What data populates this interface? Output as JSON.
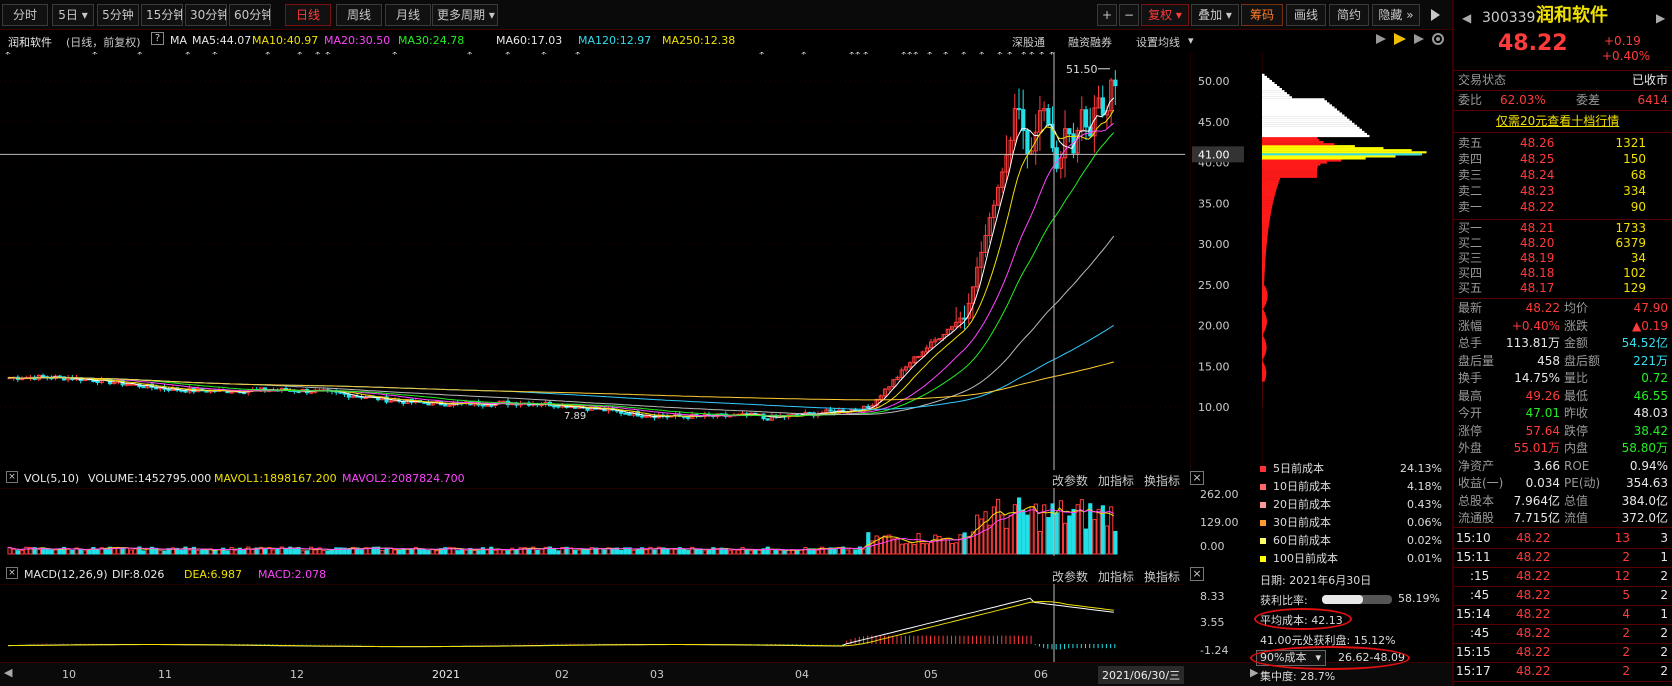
{
  "toolbar": {
    "periods": [
      "分时",
      "5日",
      "5分钟",
      "15分钟",
      "30分钟",
      "60分钟",
      "日线",
      "周线",
      "月线",
      "更多周期"
    ],
    "active_period": "日线",
    "right_buttons": [
      "+",
      "−",
      "复权",
      "叠加",
      "筹码",
      "画线",
      "简约",
      "隐藏"
    ]
  },
  "ma_line": {
    "name": "润和软件",
    "mode": "(日线，前复权)",
    "ma_label": "MA",
    "ma5": "MA5:44.07",
    "ma10": "MA10:40.97",
    "ma20": "MA20:30.50",
    "ma30": "MA30:24.78",
    "ma60": "MA60:17.03",
    "ma120": "MA120:12.97",
    "ma250": "MA250:12.38",
    "link1": "深股通",
    "link2": "融资融券",
    "link3": "设置均线"
  },
  "price_axis": {
    "ticks": [
      "50.00",
      "45.00",
      "40.00",
      "35.00",
      "30.00",
      "25.00",
      "20.00",
      "15.00",
      "10.00"
    ],
    "current_line": "41.00",
    "high_label": "51.50",
    "low_label": "7.89"
  },
  "vol_panel": {
    "label": "VOL(5,10)",
    "volume": "VOLUME:1452795.000",
    "mavol1": "MAVOL1:1898167.200",
    "mavol2": "MAVOL2:2087824.700",
    "btn_params": "改参数",
    "btn_add": "加指标",
    "btn_switch": "换指标",
    "ticks": [
      "262.00",
      "129.00",
      "0.00"
    ]
  },
  "macd_panel": {
    "label": "MACD(12,26,9)",
    "dif": "DIF:8.026",
    "dea": "DEA:6.987",
    "macd": "MACD:2.078",
    "btn_params": "改参数",
    "btn_add": "加指标",
    "btn_switch": "换指标",
    "ticks": [
      "8.33",
      "3.55",
      "-1.24"
    ]
  },
  "x_axis": {
    "labels": [
      "10",
      "11",
      "12",
      "2021",
      "02",
      "03",
      "04",
      "05",
      "06"
    ],
    "cursor_date": "2021/06/30/三"
  },
  "cost_legend": [
    {
      "label": "5日前成本",
      "value": "24.13%",
      "color": "#ff3333"
    },
    {
      "label": "10日前成本",
      "value": "4.18%",
      "color": "#ff6666"
    },
    {
      "label": "20日前成本",
      "value": "0.43%",
      "color": "#ff9999"
    },
    {
      "label": "30日前成本",
      "value": "0.06%",
      "color": "#ff9933"
    },
    {
      "label": "60日前成本",
      "value": "0.02%",
      "color": "#ffff66"
    },
    {
      "label": "100日前成本",
      "value": "0.01%",
      "color": "#ffff00"
    }
  ],
  "cost_info": {
    "date": "日期: 2021年6月30日",
    "profit_label": "获利比率:",
    "profit_value": "58.19%",
    "profit_ratio": 0.5819,
    "avg_cost": "平均成本: 42.13",
    "profit_at": "41.00元处获利盘: 15.12%",
    "range_select": "90%成本",
    "range_value": "26.62-48.09",
    "concentration": "集中度: 28.7%"
  },
  "quote": {
    "code": "300339",
    "name": "润和软件",
    "price": "48.22",
    "change": "+0.19",
    "change_pct": "+0.40%",
    "trade_status_label": "交易状态",
    "trade_status": "已收市",
    "weibi_label": "委比",
    "weibi": "62.03%",
    "weicha_label": "委差",
    "weicha": "6414",
    "promo": "仅需20元查看十档行情",
    "asks": [
      {
        "label": "卖五",
        "price": "48.26",
        "vol": "1321"
      },
      {
        "label": "卖四",
        "price": "48.25",
        "vol": "150"
      },
      {
        "label": "卖三",
        "price": "48.24",
        "vol": "68"
      },
      {
        "label": "卖二",
        "price": "48.23",
        "vol": "334"
      },
      {
        "label": "卖一",
        "price": "48.22",
        "vol": "90"
      }
    ],
    "bids": [
      {
        "label": "买一",
        "price": "48.21",
        "vol": "1733"
      },
      {
        "label": "买二",
        "price": "48.20",
        "vol": "6379"
      },
      {
        "label": "买三",
        "price": "48.19",
        "vol": "34"
      },
      {
        "label": "买四",
        "price": "48.18",
        "vol": "102"
      },
      {
        "label": "买五",
        "price": "48.17",
        "vol": "129"
      }
    ],
    "stats": [
      {
        "l1": "最新",
        "v1": "48.22",
        "c1": "red",
        "l2": "均价",
        "v2": "47.90",
        "c2": "red"
      },
      {
        "l1": "涨幅",
        "v1": "+0.40%",
        "c1": "red",
        "l2": "涨跌",
        "v2": "▲0.19",
        "c2": "red"
      },
      {
        "l1": "总手",
        "v1": "113.81万",
        "c1": "white",
        "l2": "金额",
        "v2": "54.52亿",
        "c2": "cyan"
      },
      {
        "l1": "盘后量",
        "v1": "458",
        "c1": "white",
        "l2": "盘后额",
        "v2": "221万",
        "c2": "cyan"
      },
      {
        "l1": "换手",
        "v1": "14.75%",
        "c1": "white",
        "l2": "量比",
        "v2": "0.72",
        "c2": "green"
      },
      {
        "l1": "最高",
        "v1": "49.26",
        "c1": "red",
        "l2": "最低",
        "v2": "46.55",
        "c2": "green"
      },
      {
        "l1": "今开",
        "v1": "47.01",
        "c1": "green",
        "l2": "昨收",
        "v2": "48.03",
        "c2": "white"
      },
      {
        "l1": "涨停",
        "v1": "57.64",
        "c1": "red",
        "l2": "跌停",
        "v2": "38.42",
        "c2": "green"
      },
      {
        "l1": "外盘",
        "v1": "55.01万",
        "c1": "red",
        "l2": "内盘",
        "v2": "58.80万",
        "c2": "green"
      },
      {
        "l1": "净资产",
        "v1": "3.66",
        "c1": "white",
        "l2": "ROE",
        "v2": "0.94%",
        "c2": "white"
      },
      {
        "l1": "收益(一)",
        "v1": "0.034",
        "c1": "white",
        "l2": "PE(动)",
        "v2": "354.63",
        "c2": "white"
      },
      {
        "l1": "总股本",
        "v1": "7.964亿",
        "c1": "white",
        "l2": "总值",
        "v2": "384.0亿",
        "c2": "white"
      },
      {
        "l1": "流通股",
        "v1": "7.715亿",
        "c1": "white",
        "l2": "流值",
        "v2": "372.0亿",
        "c2": "white"
      }
    ],
    "ticks": [
      {
        "time": "15:10",
        "price": "48.22",
        "vol": "13",
        "n": "3"
      },
      {
        "time": "15:11",
        "price": "48.22",
        "vol": "2",
        "n": "1"
      },
      {
        "time": ":15",
        "price": "48.22",
        "vol": "12",
        "n": "2"
      },
      {
        "time": ":45",
        "price": "48.22",
        "vol": "5",
        "n": "2"
      },
      {
        "time": "15:14",
        "price": "48.22",
        "vol": "4",
        "n": "1"
      },
      {
        "time": ":45",
        "price": "48.22",
        "vol": "2",
        "n": "2"
      },
      {
        "time": "15:15",
        "price": "48.22",
        "vol": "2",
        "n": "2"
      },
      {
        "time": "15:17",
        "price": "48.22",
        "vol": "2",
        "n": "2"
      }
    ]
  },
  "colors": {
    "up": "#ff3b3b",
    "down": "#22e0e8",
    "ma5": "#ffffff",
    "ma10": "#f0e000",
    "ma20": "#ff44ff",
    "ma30": "#22ee22",
    "ma60": "#bbbbbb",
    "ma120": "#33ccff",
    "ma250": "#ffcc33"
  }
}
